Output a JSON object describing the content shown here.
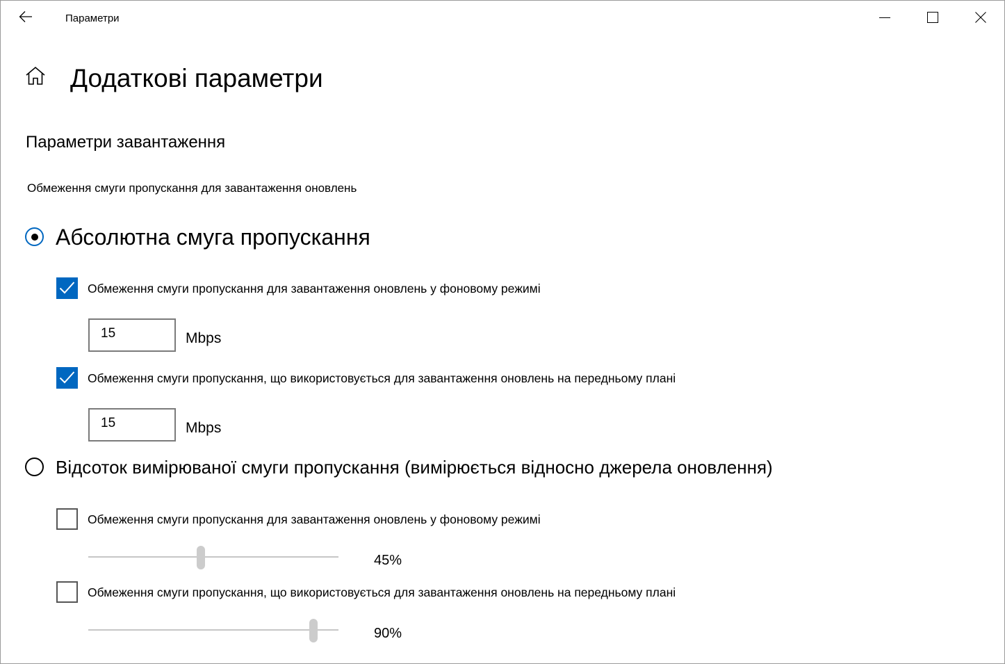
{
  "window": {
    "title": "Параметри",
    "icons": {
      "back": "back-arrow-icon",
      "minimize": "minimize-icon",
      "maximize": "maximize-icon",
      "close": "close-icon",
      "home": "home-icon"
    }
  },
  "page": {
    "title": "Додаткові параметри",
    "section_title": "Параметри завантаження",
    "subtitle": "Обмеження смуги пропускання для завантаження оновлень"
  },
  "absolute": {
    "radio_label": "Абсолютна смуга пропускання",
    "selected": true,
    "background": {
      "label": "Обмеження смуги пропускання для завантаження оновлень у фоновому режимі",
      "checked": true,
      "value": "15",
      "unit": "Mbps"
    },
    "foreground": {
      "label": "Обмеження смуги пропускання, що використовується для завантаження оновлень на передньому плані",
      "checked": true,
      "value": "15",
      "unit": "Mbps"
    }
  },
  "percentage": {
    "radio_label": "Відсоток вимірюваної смуги пропускання (вимірюється відносно джерела оновлення)",
    "selected": false,
    "background": {
      "label": "Обмеження смуги пропускання для завантаження оновлень у фоновому режимі",
      "checked": false,
      "percent": 45,
      "value_label": "45%"
    },
    "foreground": {
      "label": "Обмеження смуги пропускання, що використовується для завантаження оновлень на передньому плані",
      "checked": false,
      "percent": 90,
      "value_label": "90%"
    }
  },
  "colors": {
    "accent": "#0067c0",
    "slider_thumb": "#cccccc",
    "slider_track": "#c6c6c6"
  }
}
